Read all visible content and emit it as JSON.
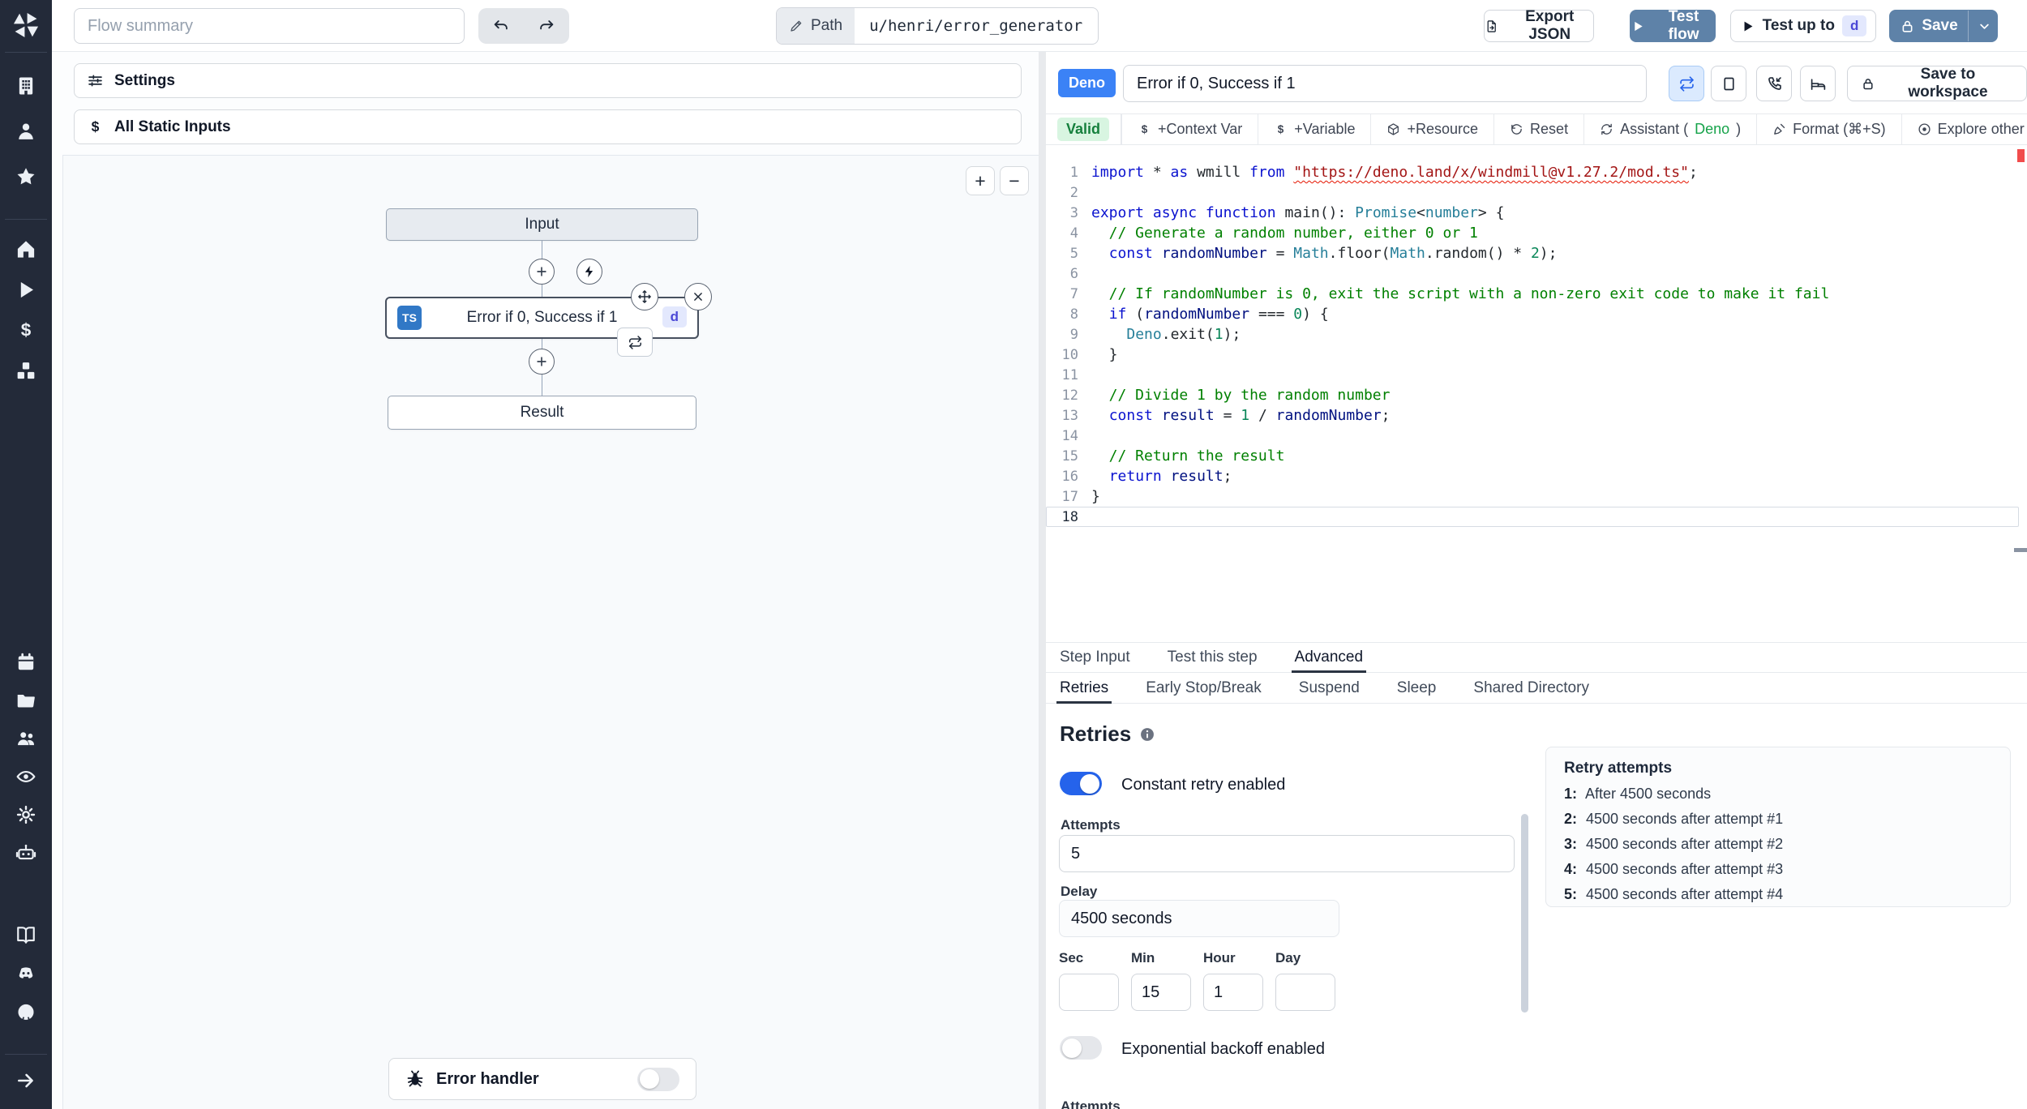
{
  "colors": {
    "topbar_button_blue": "#5e82a8",
    "deno_badge_blue": "#3b82f6",
    "toggle_on_blue": "#2563eb",
    "valid_green_text": "#15803d",
    "ts_badge_blue": "#3178c6",
    "error_squiggle_red": "#e51400"
  },
  "sidebar": {
    "groups": [
      [
        "windmill-logo"
      ],
      [
        "building",
        "user",
        "star"
      ],
      [
        "home",
        "play",
        "dollar",
        "cubes"
      ],
      [
        "calendar",
        "folder",
        "users",
        "eye",
        "gear",
        "robot"
      ],
      [
        "book",
        "discord",
        "github"
      ],
      [
        "arrow-right"
      ]
    ]
  },
  "topbar": {
    "flow_summary_placeholder": "Flow summary",
    "path_label": "Path",
    "path_value": "u/henri/error_generator",
    "export_json_label": "Export JSON",
    "test_flow_label": "Test flow",
    "test_up_to_label": "Test up to",
    "test_up_to_badge": "d",
    "save_label": "Save"
  },
  "left_panel": {
    "settings_label": "Settings",
    "all_static_inputs_label": "All Static Inputs",
    "zoom_in": "+",
    "zoom_out": "−",
    "graph": {
      "input_node_label": "Input",
      "step_lang_badge": "TS",
      "step_label": "Error if 0, Success if 1",
      "step_id_badge": "d",
      "result_node_label": "Result",
      "error_handler_label": "Error handler",
      "error_handler_enabled": false
    }
  },
  "right_panel": {
    "lang_badge": "Deno",
    "step_name": "Error if 0, Success if 1",
    "save_to_workspace_label": "Save to workspace",
    "toolbar": {
      "valid_label": "Valid",
      "context_var_label": "+Context Var",
      "variable_label": "+Variable",
      "resource_label": "+Resource",
      "reset_label": "Reset",
      "assistant_prefix": "Assistant (",
      "assistant_lang": "Deno",
      "assistant_suffix": ")",
      "format_label": "Format (⌘+S)",
      "explore_label": "Explore other s"
    },
    "editor": {
      "lines": [
        [
          [
            "k",
            "import"
          ],
          [
            "p",
            " * "
          ],
          [
            "k",
            "as"
          ],
          [
            "p",
            " wmill "
          ],
          [
            "k",
            "from"
          ],
          [
            "p",
            " "
          ],
          [
            "su",
            "\"https://deno.land/x/windmill@v1.27.2/mod.ts\""
          ],
          [
            "p",
            ";"
          ]
        ],
        [],
        [
          [
            "k",
            "export"
          ],
          [
            "p",
            " "
          ],
          [
            "k",
            "async"
          ],
          [
            "p",
            " "
          ],
          [
            "k",
            "function"
          ],
          [
            "p",
            " "
          ],
          [
            "f",
            "main"
          ],
          [
            "p",
            "(): "
          ],
          [
            "t",
            "Promise"
          ],
          [
            "p",
            "<"
          ],
          [
            "t",
            "number"
          ],
          [
            "p",
            "> {"
          ]
        ],
        [
          [
            "c",
            "  // Generate a random number, either 0 or 1"
          ]
        ],
        [
          [
            "p",
            "  "
          ],
          [
            "k",
            "const"
          ],
          [
            "p",
            " "
          ],
          [
            "v",
            "randomNumber"
          ],
          [
            "p",
            " = "
          ],
          [
            "t",
            "Math"
          ],
          [
            "p",
            "."
          ],
          [
            "f",
            "floor"
          ],
          [
            "p",
            "("
          ],
          [
            "t",
            "Math"
          ],
          [
            "p",
            "."
          ],
          [
            "f",
            "random"
          ],
          [
            "p",
            "() * "
          ],
          [
            "n",
            "2"
          ],
          [
            "p",
            ");"
          ]
        ],
        [],
        [
          [
            "c",
            "  // If randomNumber is 0, exit the script with a non-zero exit code to make it fail"
          ]
        ],
        [
          [
            "p",
            "  "
          ],
          [
            "k",
            "if"
          ],
          [
            "p",
            " ("
          ],
          [
            "v",
            "randomNumber"
          ],
          [
            "p",
            " === "
          ],
          [
            "n",
            "0"
          ],
          [
            "p",
            ") {"
          ]
        ],
        [
          [
            "p",
            "    "
          ],
          [
            "t",
            "Deno"
          ],
          [
            "p",
            "."
          ],
          [
            "f",
            "exit"
          ],
          [
            "p",
            "("
          ],
          [
            "n",
            "1"
          ],
          [
            "p",
            ");"
          ]
        ],
        [
          [
            "p",
            "  }"
          ]
        ],
        [],
        [
          [
            "c",
            "  // Divide 1 by the random number"
          ]
        ],
        [
          [
            "p",
            "  "
          ],
          [
            "k",
            "const"
          ],
          [
            "p",
            " "
          ],
          [
            "v",
            "result"
          ],
          [
            "p",
            " = "
          ],
          [
            "n",
            "1"
          ],
          [
            "p",
            " / "
          ],
          [
            "v",
            "randomNumber"
          ],
          [
            "p",
            ";"
          ]
        ],
        [],
        [
          [
            "c",
            "  // Return the result"
          ]
        ],
        [
          [
            "p",
            "  "
          ],
          [
            "k",
            "return"
          ],
          [
            "p",
            " "
          ],
          [
            "v",
            "result"
          ],
          [
            "p",
            ";"
          ]
        ],
        [
          [
            "p",
            "}"
          ]
        ],
        []
      ]
    },
    "tabs": [
      "Step Input",
      "Test this step",
      "Advanced"
    ],
    "active_tab": "Advanced",
    "subtabs": [
      "Retries",
      "Early Stop/Break",
      "Suspend",
      "Sleep",
      "Shared Directory"
    ],
    "active_subtab": "Retries",
    "retries": {
      "heading": "Retries",
      "constant_label": "Constant retry enabled",
      "constant_enabled": true,
      "attempts_label": "Attempts",
      "attempts_value": "5",
      "delay_label": "Delay",
      "delay_value": "4500 seconds",
      "time_fields": [
        {
          "label": "Sec",
          "value": ""
        },
        {
          "label": "Min",
          "value": "15"
        },
        {
          "label": "Hour",
          "value": "1"
        },
        {
          "label": "Day",
          "value": ""
        }
      ],
      "exponential_label": "Exponential backoff enabled",
      "exponential_enabled": false,
      "cutoff_label": "Attempts",
      "preview": {
        "title": "Retry attempts",
        "items": [
          {
            "n": "1:",
            "text": "After 4500 seconds"
          },
          {
            "n": "2:",
            "text": "4500 seconds after attempt #1"
          },
          {
            "n": "3:",
            "text": "4500 seconds after attempt #2"
          },
          {
            "n": "4:",
            "text": "4500 seconds after attempt #3"
          },
          {
            "n": "5:",
            "text": "4500 seconds after attempt #4"
          }
        ]
      }
    }
  }
}
